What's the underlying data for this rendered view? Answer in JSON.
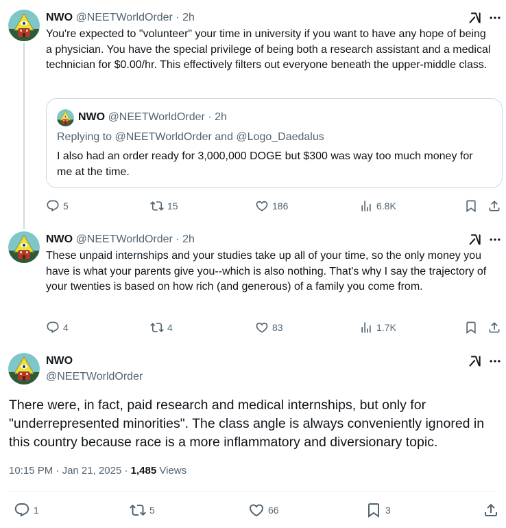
{
  "colors": {
    "text": "#0f1419",
    "muted": "#536471",
    "border": "#cfd9de",
    "divider": "#eff3f4"
  },
  "posts": [
    {
      "name": "NWO",
      "handle": "@NEETWorldOrder",
      "time": "2h",
      "text": "You're expected to \"volunteer\" your time in university if you want to have any hope of being a physician. You have the special privilege of being both a research assistant and a medical technician for $0.00/hr. This effectively filters out everyone beneath the upper-middle class.",
      "quote": {
        "name": "NWO",
        "handle": "@NEETWorldOrder",
        "time": "2h",
        "replying_prefix": "Replying to",
        "replying_user1": "@NEETWorldOrder",
        "replying_and": "and",
        "replying_user2": "@Logo_Daedalus",
        "text": "I also had an order ready for 3,000,000 DOGE but $300 was way too much money for me at the time."
      },
      "replies": "5",
      "reposts": "15",
      "likes": "186",
      "views": "6.8K"
    },
    {
      "name": "NWO",
      "handle": "@NEETWorldOrder",
      "time": "2h",
      "text": "These unpaid internships and your studies take up all of your time, so the only money you have is what your parents give you--which is also nothing. That's why I say the trajectory of your twenties is based on how rich (and generous) of a family you come from.",
      "replies": "4",
      "reposts": "4",
      "likes": "83",
      "views": "1.7K"
    }
  ],
  "main": {
    "name": "NWO",
    "handle": "@NEETWorldOrder",
    "text": "There were, in fact, paid research and medical internships, but only for \"underrepresented minorities\". The class angle is always conveniently ignored in this country because race is a more inflammatory and diversionary topic.",
    "time": "10:15 PM",
    "date": "Jan 21, 2025",
    "views_count": "1,485",
    "views_label": "Views",
    "replies": "1",
    "reposts": "5",
    "likes": "66",
    "bookmarks": "3"
  }
}
